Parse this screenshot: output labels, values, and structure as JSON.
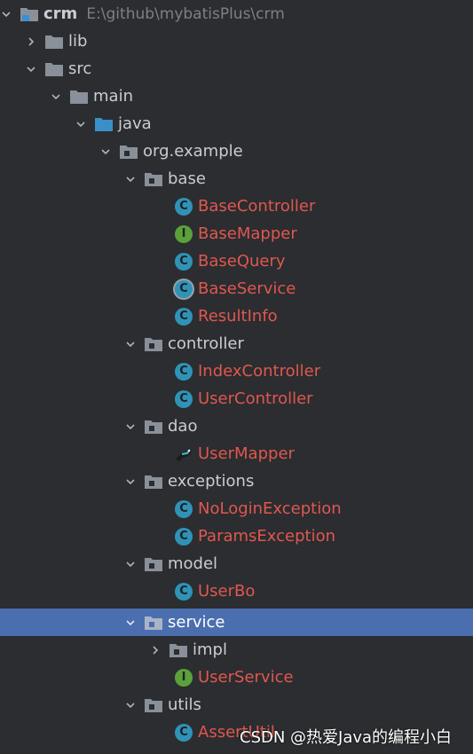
{
  "project": {
    "name": "crm",
    "path": "E:\\github\\mybatisPlus\\crm"
  },
  "nodes": [
    {
      "label": "lib",
      "type": "folder",
      "expanded": false
    },
    {
      "label": "src",
      "type": "folder",
      "expanded": true
    },
    {
      "label": "main",
      "type": "folder",
      "expanded": true
    },
    {
      "label": "java",
      "type": "source-folder",
      "expanded": true
    },
    {
      "label": "org.example",
      "type": "package",
      "expanded": true
    },
    {
      "label": "base",
      "type": "package",
      "expanded": true
    },
    {
      "label": "BaseController",
      "type": "class"
    },
    {
      "label": "BaseMapper",
      "type": "interface"
    },
    {
      "label": "BaseQuery",
      "type": "class"
    },
    {
      "label": "BaseService",
      "type": "abstract-class"
    },
    {
      "label": "ResultInfo",
      "type": "class"
    },
    {
      "label": "controller",
      "type": "package",
      "expanded": true
    },
    {
      "label": "IndexController",
      "type": "class"
    },
    {
      "label": "UserController",
      "type": "class"
    },
    {
      "label": "dao",
      "type": "package",
      "expanded": true
    },
    {
      "label": "UserMapper",
      "type": "mybatis-mapper"
    },
    {
      "label": "exceptions",
      "type": "package",
      "expanded": true
    },
    {
      "label": "NoLoginException",
      "type": "class"
    },
    {
      "label": "ParamsException",
      "type": "class"
    },
    {
      "label": "model",
      "type": "package",
      "expanded": true
    },
    {
      "label": "UserBo",
      "type": "class"
    },
    {
      "label": "service",
      "type": "package",
      "expanded": true,
      "selected": true
    },
    {
      "label": "impl",
      "type": "package",
      "expanded": false
    },
    {
      "label": "UserService",
      "type": "interface"
    },
    {
      "label": "utils",
      "type": "package",
      "expanded": true
    },
    {
      "label": "AssertUtil",
      "type": "class"
    }
  ],
  "watermark": "CSDN @热爱Java的编程小白",
  "colors": {
    "background": "#2b2d30",
    "selection": "#4b6eaf",
    "modified_file": "#e0574f",
    "class_icon": "#2f93b7",
    "interface_icon": "#5aa13a"
  }
}
